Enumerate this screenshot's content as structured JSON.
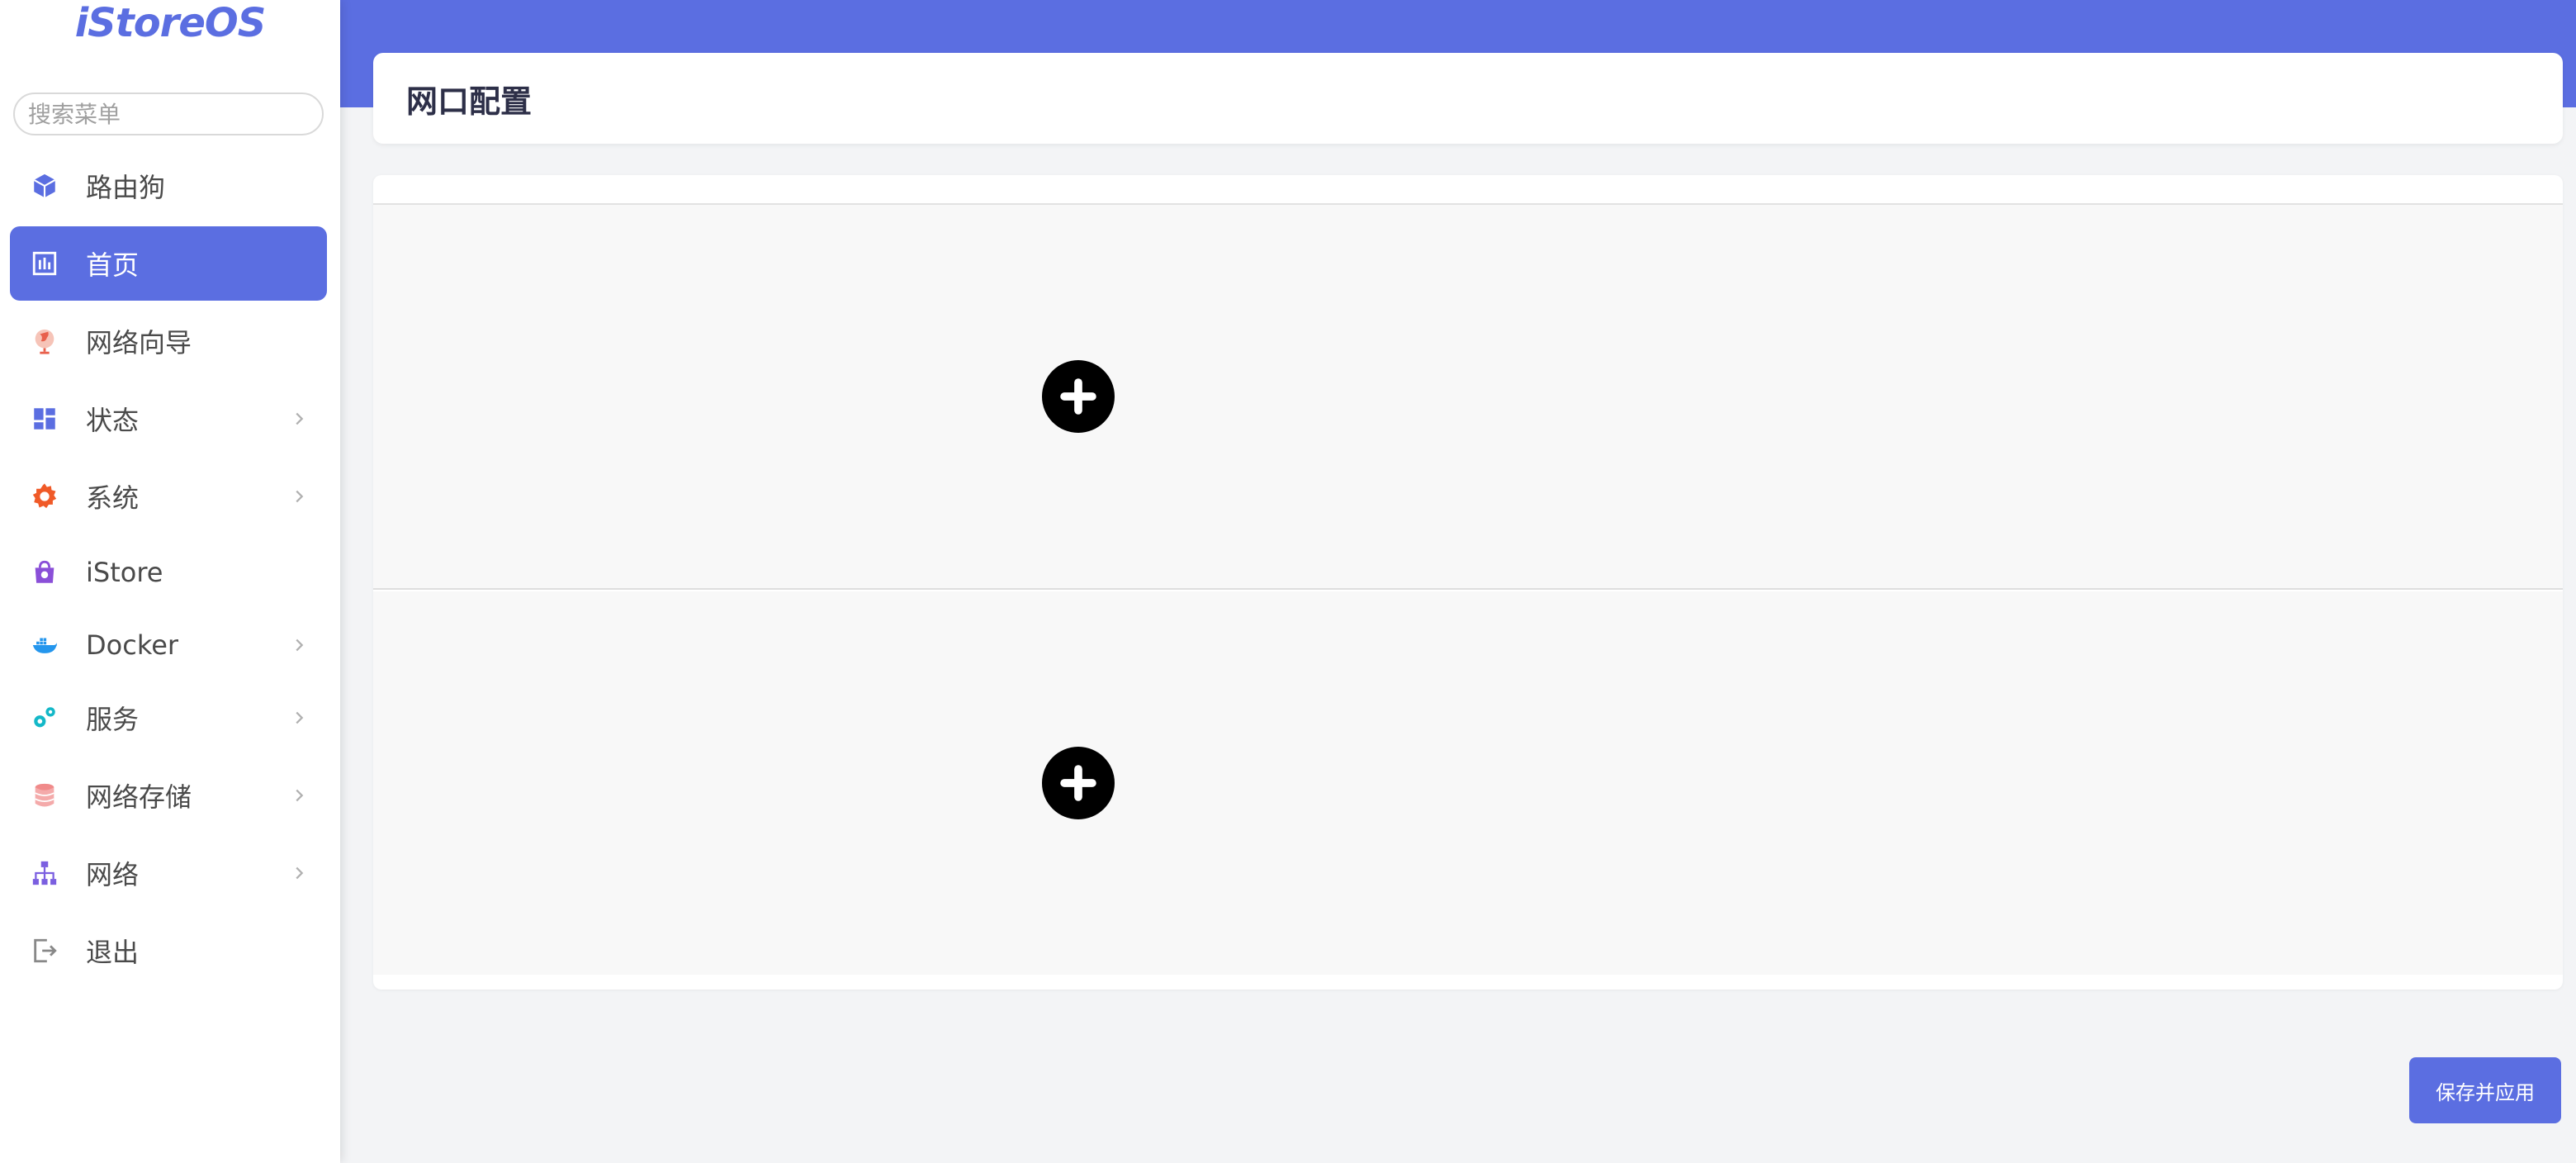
{
  "sidebar": {
    "logo": "iStoreOS",
    "search_placeholder": "搜索菜单",
    "items": [
      {
        "label": "路由狗",
        "icon": "cube-icon",
        "color": "#5b6ee1"
      },
      {
        "label": "首页",
        "icon": "dashboard-icon",
        "active": true
      },
      {
        "label": "网络向导",
        "icon": "globe-icon",
        "color": "#e8604c"
      },
      {
        "label": "状态",
        "icon": "grid-icon",
        "color": "#5b6ee1",
        "has_children": true
      },
      {
        "label": "系统",
        "icon": "gear-icon",
        "color": "#f05a28",
        "has_children": true
      },
      {
        "label": "iStore",
        "icon": "bag-icon",
        "color": "#8a4fd8"
      },
      {
        "label": "Docker",
        "icon": "docker-icon",
        "color": "#2496ed",
        "has_children": true
      },
      {
        "label": "服务",
        "icon": "cogs-icon",
        "color": "#14b8c8",
        "has_children": true
      },
      {
        "label": "网络存储",
        "icon": "database-icon",
        "color": "#f08a8a",
        "has_children": true
      },
      {
        "label": "网络",
        "icon": "sitemap-icon",
        "color": "#7b5fe0",
        "has_children": true
      },
      {
        "label": "退出",
        "icon": "logout-icon",
        "color": "#888888"
      }
    ]
  },
  "page": {
    "title": "网口配置"
  },
  "actions": {
    "save_label": "保存并应用"
  },
  "colors": {
    "accent": "#5b6ee1",
    "background": "#f3f4f6"
  }
}
